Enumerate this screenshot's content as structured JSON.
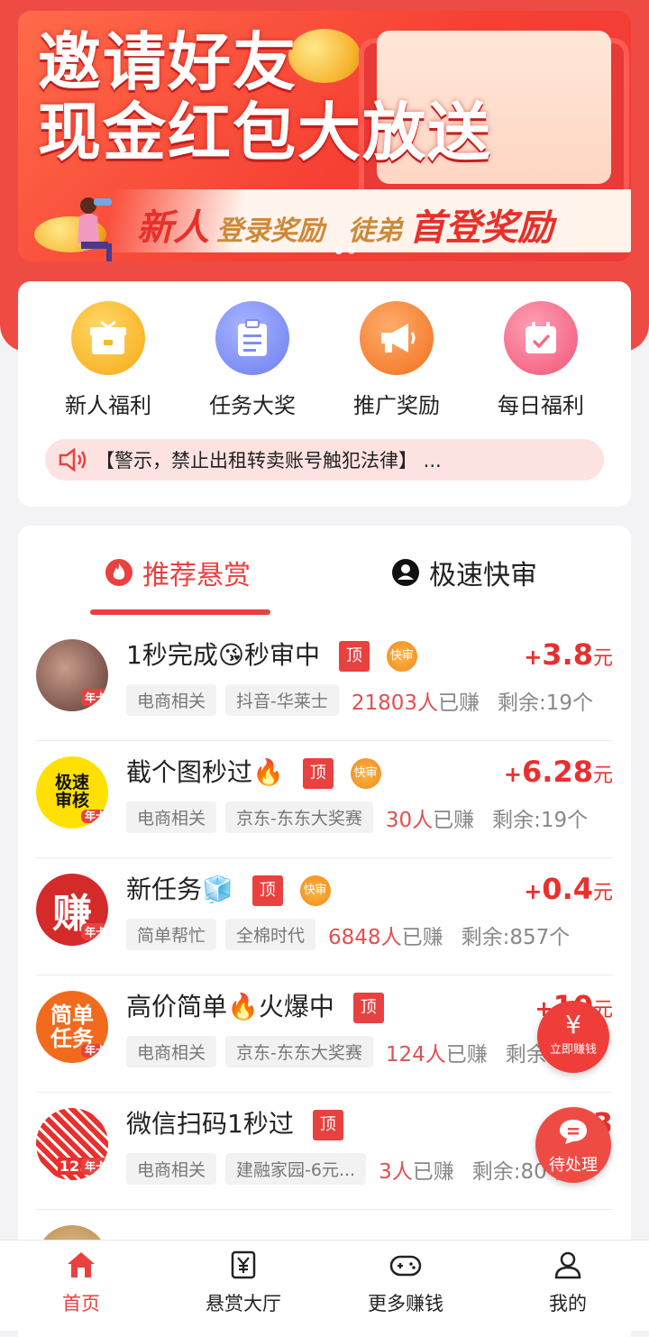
{
  "banner": {
    "title_line1": "邀请好友",
    "title_line2": "现金红包大放送",
    "strip_part1": "新人",
    "strip_part2": "登录奖励",
    "strip_part3": "徒弟",
    "strip_part4": "首登奖励"
  },
  "quick_menu": [
    {
      "label": "新人福利",
      "icon": "gift-icon",
      "color": "#f7b82a"
    },
    {
      "label": "任务大奖",
      "icon": "clipboard-icon",
      "color": "#7c8df5"
    },
    {
      "label": "推广奖励",
      "icon": "megaphone-icon",
      "color": "#f5812a"
    },
    {
      "label": "每日福利",
      "icon": "calendar-check-icon",
      "color": "#f56c8a"
    }
  ],
  "notice": {
    "text": "【警示，禁止出租转卖账号触犯法律】 ..."
  },
  "tabs": [
    {
      "label": "推荐悬赏",
      "icon": "fire-icon"
    },
    {
      "label": "极速快审",
      "icon": "user-circle-icon"
    }
  ],
  "tasks": [
    {
      "title": "1秒完成😘秒审中",
      "top": "顶",
      "fast": "快审",
      "price_plus": "+",
      "price": "3.8",
      "unit": "元",
      "tag1": "电商相关",
      "tag2": "抖音-华莱士",
      "earned_num": "21803人",
      "earned_suffix": "已赚",
      "remain": "剩余:19个",
      "badge": "年卡"
    },
    {
      "title": "截个图秒过🔥",
      "top": "顶",
      "fast": "快审",
      "price_plus": "+",
      "price": "6.28",
      "unit": "元",
      "tag1": "电商相关",
      "tag2": "京东-东东大奖赛",
      "earned_num": "30人",
      "earned_suffix": "已赚",
      "remain": "剩余:19个",
      "avatar_text": "极速审核",
      "badge": "年卡"
    },
    {
      "title": "新任务🧊",
      "top": "顶",
      "fast": "快审",
      "price_plus": "+",
      "price": "0.4",
      "unit": "元",
      "tag1": "简单帮忙",
      "tag2": "全棉时代",
      "earned_num": "6848人",
      "earned_suffix": "已赚",
      "remain": "剩余:857个",
      "avatar_text": "赚",
      "badge": "年卡"
    },
    {
      "title": "高价简单🔥火爆中",
      "top": "顶",
      "fast": "",
      "price_plus": "+",
      "price": "10",
      "unit": "元",
      "tag1": "电商相关",
      "tag2": "京东-东东大奖赛",
      "earned_num": "124人",
      "earned_suffix": "已赚",
      "remain": "剩余",
      "avatar_text": "简单任务",
      "badge": "年卡"
    },
    {
      "title": "微信扫码1秒过",
      "top": "顶",
      "fast": "",
      "price_plus": "+",
      "price": "3",
      "unit": "",
      "tag1": "电商相关",
      "tag2": "建融家园-6元...",
      "earned_num": "3人",
      "earned_suffix": "已赚",
      "remain": "剩余:80个",
      "avatar_text": "12.",
      "badge": "年卡"
    }
  ],
  "floating": {
    "earn_icon": "¥",
    "earn_label": "立即赚钱",
    "todo_label": "待处理"
  },
  "bottom_nav": [
    {
      "label": "首页",
      "icon": "home-icon",
      "active": true
    },
    {
      "label": "悬赏大厅",
      "icon": "yen-doc-icon",
      "active": false
    },
    {
      "label": "更多赚钱",
      "icon": "gamepad-icon",
      "active": false
    },
    {
      "label": "我的",
      "icon": "person-icon",
      "active": false
    }
  ],
  "colors": {
    "accent": "#e8413f",
    "header": "#ef4b45"
  }
}
